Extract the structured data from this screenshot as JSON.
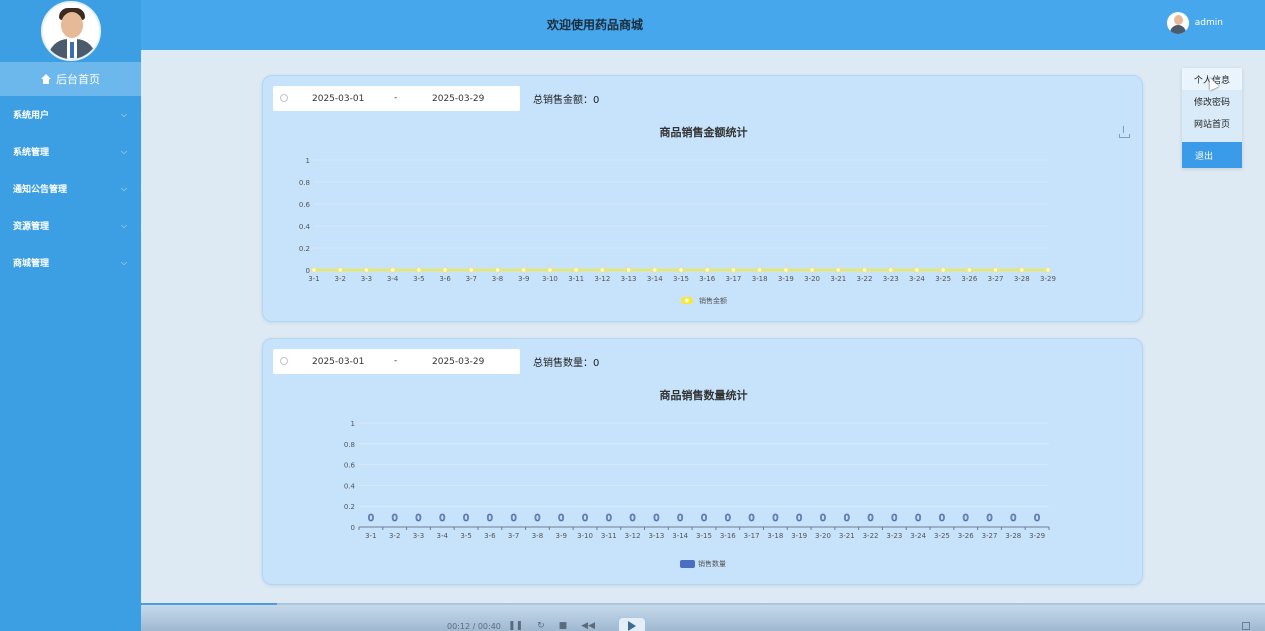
{
  "header": {
    "title": "欢迎使用药品商城",
    "user": "admin"
  },
  "sidebar": {
    "home": "后台首页",
    "items": [
      {
        "label": "系统用户"
      },
      {
        "label": "系统管理"
      },
      {
        "label": "通知公告管理"
      },
      {
        "label": "资源管理"
      },
      {
        "label": "商城管理"
      }
    ]
  },
  "dropdown": {
    "items": [
      "个人信息",
      "修改密码",
      "网站首页"
    ],
    "logout": "退出"
  },
  "sales_amount": {
    "start_date": "2025-03-01",
    "separator": "-",
    "end_date": "2025-03-29",
    "total_label": "总销售金额：",
    "total_value": "0"
  },
  "sales_quantity": {
    "start_date": "2025-03-01",
    "separator": "-",
    "end_date": "2025-03-29",
    "total_label": "总销售数量：",
    "total_value": "0"
  },
  "media": {
    "time": "00:12 / 00:40"
  },
  "colors": {
    "line_series": "#f5e93a",
    "bar_series": "#4a6fc0",
    "sidebar": "#3d9fe3",
    "header": "#46a7ec",
    "card": "#c7e3fb"
  },
  "chart_data": [
    {
      "type": "line",
      "title": "商品销售金额统计",
      "categories": [
        "3-1",
        "3-2",
        "3-3",
        "3-4",
        "3-5",
        "3-6",
        "3-7",
        "3-8",
        "3-9",
        "3-10",
        "3-11",
        "3-12",
        "3-13",
        "3-14",
        "3-15",
        "3-16",
        "3-17",
        "3-18",
        "3-19",
        "3-20",
        "3-21",
        "3-22",
        "3-23",
        "3-24",
        "3-25",
        "3-26",
        "3-27",
        "3-28",
        "3-29"
      ],
      "series": [
        {
          "name": "销售金额",
          "values": [
            0,
            0,
            0,
            0,
            0,
            0,
            0,
            0,
            0,
            0,
            0,
            0,
            0,
            0,
            0,
            0,
            0,
            0,
            0,
            0,
            0,
            0,
            0,
            0,
            0,
            0,
            0,
            0,
            0
          ]
        }
      ],
      "ylim": [
        0,
        1
      ],
      "yticks": [
        "0",
        "0.2",
        "0.4",
        "0.6",
        "0.8",
        "1"
      ],
      "legend": "bottom-center",
      "grid": true
    },
    {
      "type": "bar",
      "title": "商品销售数量统计",
      "categories": [
        "3-1",
        "3-2",
        "3-3",
        "3-4",
        "3-5",
        "3-6",
        "3-7",
        "3-8",
        "3-9",
        "3-10",
        "3-11",
        "3-12",
        "3-13",
        "3-14",
        "3-15",
        "3-16",
        "3-17",
        "3-18",
        "3-19",
        "3-20",
        "3-21",
        "3-22",
        "3-23",
        "3-24",
        "3-25",
        "3-26",
        "3-27",
        "3-28",
        "3-29"
      ],
      "series": [
        {
          "name": "销售数量",
          "values": [
            0,
            0,
            0,
            0,
            0,
            0,
            0,
            0,
            0,
            0,
            0,
            0,
            0,
            0,
            0,
            0,
            0,
            0,
            0,
            0,
            0,
            0,
            0,
            0,
            0,
            0,
            0,
            0,
            0
          ]
        }
      ],
      "data_labels": true,
      "ylim": [
        0,
        1
      ],
      "yticks": [
        "0",
        "0.2",
        "0.4",
        "0.6",
        "0.8",
        "1"
      ],
      "legend": "bottom-center",
      "grid": true
    }
  ]
}
